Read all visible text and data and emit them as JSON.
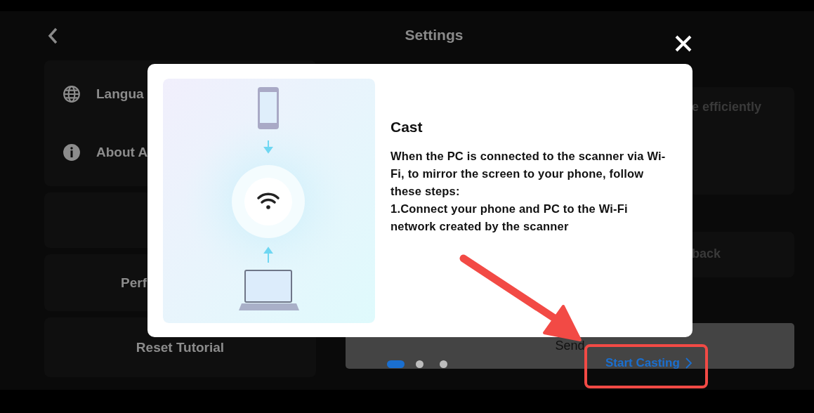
{
  "header": {
    "title": "Settings"
  },
  "left_cards": [
    {
      "kind": "list",
      "items": [
        {
          "label": "Langua"
        },
        {
          "label": "About A"
        }
      ]
    },
    {
      "kind": "blank"
    },
    {
      "kind": "centered",
      "label": "Perf"
    },
    {
      "kind": "centered",
      "label": "Reset Tutorial"
    }
  ],
  "right_cards": [
    {
      "kind": "text",
      "label": "e efficiently"
    },
    {
      "kind": "short",
      "label": "back"
    },
    {
      "kind": "send",
      "label": "Send"
    }
  ],
  "dialog": {
    "title": "Cast",
    "description": "When the PC is connected to the scanner via Wi-Fi, to mirror the screen to your phone, follow these steps:",
    "steps": [
      "1.Connect your phone and PC to the Wi-Fi network created by the scanner"
    ],
    "pages": [
      {
        "selected": true
      },
      {
        "selected": false
      },
      {
        "selected": false
      }
    ],
    "action": "Start Casting"
  }
}
